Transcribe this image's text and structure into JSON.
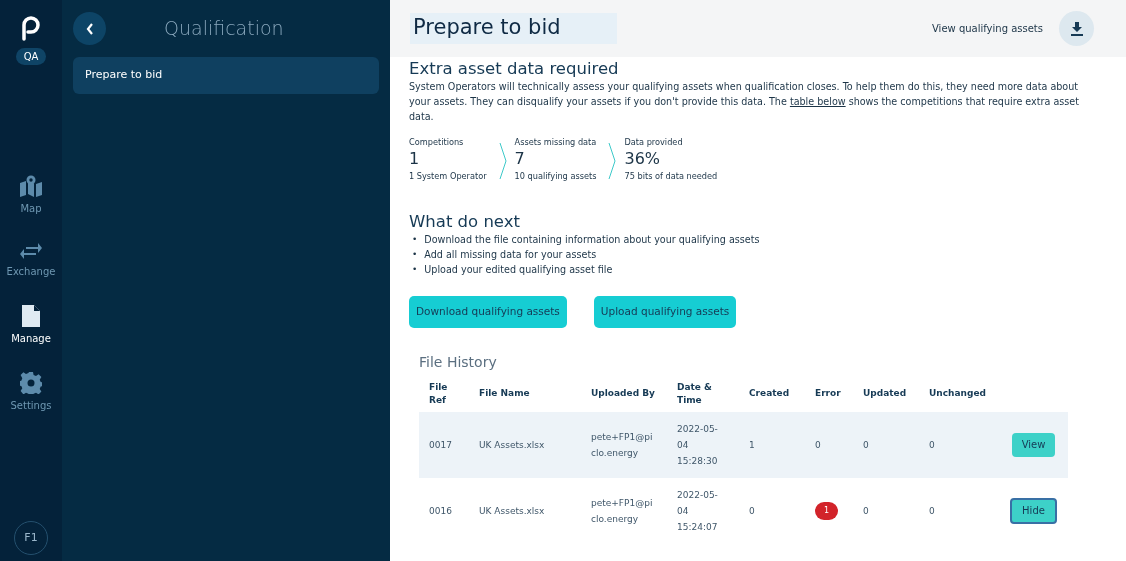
{
  "rail": {
    "badge": "QA",
    "items": [
      {
        "label": "Map",
        "kind": "map",
        "selected": false
      },
      {
        "label": "Exchange",
        "kind": "exchange",
        "selected": false
      },
      {
        "label": "Manage",
        "kind": "manage",
        "selected": true
      },
      {
        "label": "Settings",
        "kind": "settings",
        "selected": false
      }
    ],
    "avatar": "F1"
  },
  "sidebar": {
    "title": "Qualification",
    "items": [
      {
        "label": "Prepare to bid",
        "selected": true
      }
    ]
  },
  "header": {
    "title": "Prepare to bid",
    "link": "View qualifying assets"
  },
  "section": {
    "title": "Extra asset data required",
    "text": "System Operators will technically assess your qualifying assets when qualification closes. To help them do this, they need more data about your assets. They can disqualify your assets if you don't provide this data. The ",
    "link": "table below",
    "text_after": " shows the competitions that require extra asset data."
  },
  "stats": [
    {
      "label": "Competitions",
      "value": "1",
      "note": "1 System Operator"
    },
    {
      "label": "Assets missing data",
      "value": "7",
      "note": "10 qualifying assets"
    },
    {
      "label": "Data provided",
      "value": "36%",
      "note": "75 bits of data needed"
    }
  ],
  "next": {
    "title": "What do next",
    "bullet": "•",
    "steps": [
      "Download the file containing information about your qualifying assets",
      "Add all missing data for your assets",
      "Upload your edited qualifying asset file"
    ]
  },
  "buttons": [
    "Download qualifying assets",
    "Upload qualifying assets"
  ],
  "history": {
    "title": "File History",
    "columns": [
      "File Ref",
      "File Name",
      "Uploaded By",
      "Date & Time",
      "Created",
      "Error",
      "Updated",
      "Unchanged"
    ],
    "rows": [
      {
        "cells": [
          "0017",
          "UK Assets.xlsx",
          "pete+FP1@pi clo.energy",
          "2022-05- 04 15:28:30",
          "1",
          "0",
          "0",
          "0"
        ],
        "error_badge": false,
        "selected": true,
        "action": "View",
        "action_focused": false
      },
      {
        "cells": [
          "0016",
          "UK Assets.xlsx",
          "pete+FP1@pi clo.energy",
          "2022-05- 04 15:24:07",
          "0",
          "1",
          "0",
          "0"
        ],
        "error_badge": true,
        "selected": false,
        "action": "Hide",
        "action_focused": true
      }
    ]
  }
}
